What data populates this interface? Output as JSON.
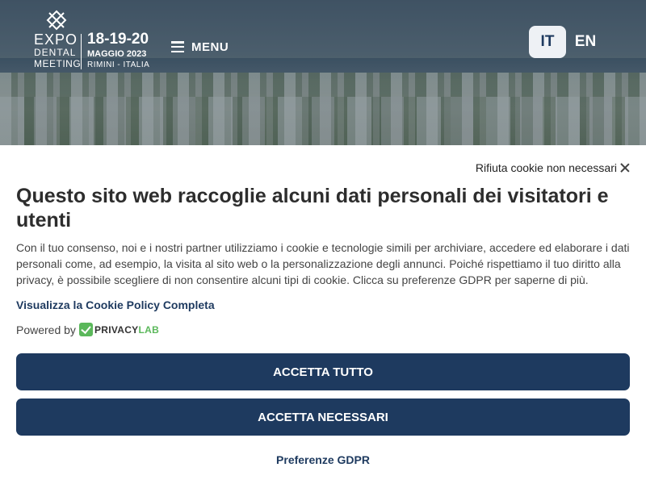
{
  "header": {
    "logo": {
      "line1": "EXPO",
      "line2": "DENTAL",
      "line3": "MEETING",
      "dates": "18-19-20",
      "month": "MAGGIO 2023",
      "place": "RIMINI - ITALIA"
    },
    "menu_label": "MENU",
    "languages": [
      {
        "code": "IT",
        "active": true
      },
      {
        "code": "EN",
        "active": false
      }
    ]
  },
  "cookie_banner": {
    "reject_label": "Rifiuta cookie non necessari",
    "title": "Questo sito web raccoglie alcuni dati personali dei visitatori e utenti",
    "description": "Con il tuo consenso, noi e i nostri partner utilizziamo i cookie e tecnologie simili per archiviare, accedere ed elaborare i dati personali come, ad esempio, la visita al sito web o la personalizzazione degli annunci. Poiché rispettiamo il tuo diritto alla privacy, è possibile scegliere di non consentire alcuni tipi di cookie. Clicca su preferenze GDPR per saperne di più.",
    "policy_link": "Visualizza la Cookie Policy Completa",
    "powered_by": "Powered by",
    "brand_part1": "PRIVACY",
    "brand_part2": "LAB",
    "accept_all": "ACCETTA TUTTO",
    "accept_necessary": "ACCETTA NECESSARI",
    "preferences": "Preferenze GDPR"
  },
  "colors": {
    "primary": "#1e3a5f",
    "brand_green": "#5bb85b",
    "text": "#444444"
  }
}
